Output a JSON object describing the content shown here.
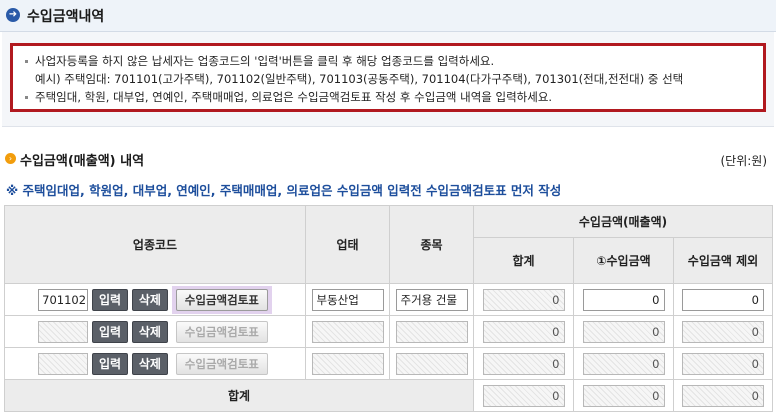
{
  "page": {
    "title": "수입금액내역"
  },
  "notice": {
    "line1": "사업자등록을 하지 않은 납세자는 업종코드의 '입력'버튼을 클릭 후 해당 업종코드를 입력하세요.",
    "line2": "예시) 주택임대: 701101(고가주택), 701102(일반주택), 701103(공동주택), 701104(다가구주택), 701301(전대,전전대) 중 선택",
    "line3": "주택임대, 학원, 대부업, 연예인, 주택매매업, 의료업은 수입금액검토표 작성 후 수입금액 내역을 입력하세요."
  },
  "section": {
    "title": "수입금액(매출액) 내역",
    "unit": "(단위:원)",
    "warning": "※ 주택임대업, 학원업, 대부업, 연예인, 주택매매업, 의료업은 수입금액 입력전 수입금액검토표 먼저 작성"
  },
  "table": {
    "headers": {
      "industry_code": "업종코드",
      "business_type": "업태",
      "category": "종목",
      "income_group": "수입금액(매출액)",
      "total": "합계",
      "income": "①수입금액",
      "excluded": "수입금액 제외"
    },
    "buttons": {
      "input": "입력",
      "delete": "삭제",
      "review": "수입금액검토표"
    },
    "rows": [
      {
        "code": "701102",
        "business_type": "부동산업",
        "category": "주거용 건물",
        "total": "0",
        "income": "0",
        "excluded": "0"
      },
      {
        "code": "",
        "business_type": "",
        "category": "",
        "total": "0",
        "income": "0",
        "excluded": "0"
      },
      {
        "code": "",
        "business_type": "",
        "category": "",
        "total": "0",
        "income": "0",
        "excluded": "0"
      }
    ],
    "footer": {
      "label": "합계",
      "total": "0",
      "income": "0",
      "excluded": "0"
    }
  }
}
